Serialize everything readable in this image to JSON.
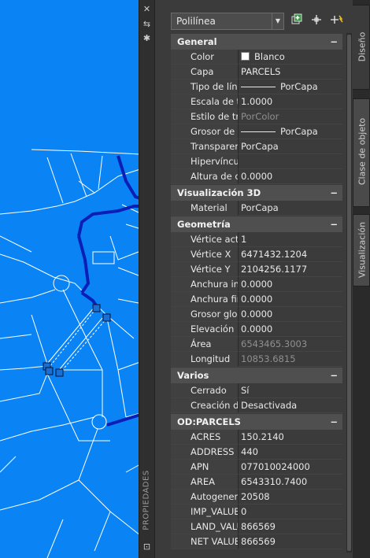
{
  "colors": {
    "background": "#0a84f5",
    "panel": "#3b3b3b",
    "lines": "#ffffff",
    "roads": "#0b1fb7"
  },
  "palette": {
    "title": "PROPIEDADES",
    "selector_value": "Polilínea",
    "toolbar_icons": [
      "quick-select-icon",
      "pick-point-icon",
      "toggle-pickadd-icon"
    ],
    "left_icons": [
      "close-icon",
      "autohide-icon",
      "properties-menu-icon"
    ],
    "tabs": [
      "Diseño",
      "Clase de objeto",
      "Visualización"
    ]
  },
  "sections": [
    {
      "title": "General",
      "toggle": "−",
      "rows": [
        {
          "label": "Color",
          "value": "Blanco",
          "swatch": true
        },
        {
          "label": "Capa",
          "value": "PARCELS"
        },
        {
          "label": "Tipo de línea",
          "value": "PorCapa",
          "line": true
        },
        {
          "label": "Escala de tip...",
          "value": "1.0000"
        },
        {
          "label": "Estilo de traz...",
          "value": "PorColor",
          "readonly": true
        },
        {
          "label": "Grosor de lí...",
          "value": "PorCapa",
          "line": true
        },
        {
          "label": "Transparencia",
          "value": "PorCapa"
        },
        {
          "label": "Hipervínculo",
          "value": ""
        },
        {
          "label": "Altura de ob...",
          "value": "0.0000"
        }
      ]
    },
    {
      "title": "Visualización 3D",
      "toggle": "−",
      "rows": [
        {
          "label": "Material",
          "value": "PorCapa"
        }
      ]
    },
    {
      "title": "Geometría",
      "toggle": "−",
      "rows": [
        {
          "label": "Vértice actual",
          "value": "1"
        },
        {
          "label": "Vértice X",
          "value": "6471432.1204"
        },
        {
          "label": "Vértice Y",
          "value": "2104256.1177"
        },
        {
          "label": "Anchura inic...",
          "value": "0.0000"
        },
        {
          "label": "Anchura fina...",
          "value": "0.0000"
        },
        {
          "label": "Grosor global",
          "value": "0.0000"
        },
        {
          "label": "Elevación",
          "value": "0.0000"
        },
        {
          "label": "Área",
          "value": "6543465.3003",
          "readonly": true
        },
        {
          "label": "Longitud",
          "value": "10853.6815",
          "readonly": true
        }
      ]
    },
    {
      "title": "Varios",
      "toggle": "−",
      "rows": [
        {
          "label": "Cerrado",
          "value": "Sí"
        },
        {
          "label": "Creación de...",
          "value": "Desactivada"
        }
      ]
    },
    {
      "title": "OD:PARCELS",
      "toggle": "−",
      "rows": [
        {
          "label": "ACRES",
          "value": "150.2140"
        },
        {
          "label": "ADDRESS",
          "value": "440"
        },
        {
          "label": "APN",
          "value": "077010024000"
        },
        {
          "label": "AREA",
          "value": "6543310.7400"
        },
        {
          "label": "Autogenerat...",
          "value": "20508"
        },
        {
          "label": "IMP_VALUE",
          "value": "0"
        },
        {
          "label": "LAND_VALUE",
          "value": "866569"
        },
        {
          "label": "NET VALUE",
          "value": "866569"
        }
      ]
    }
  ]
}
